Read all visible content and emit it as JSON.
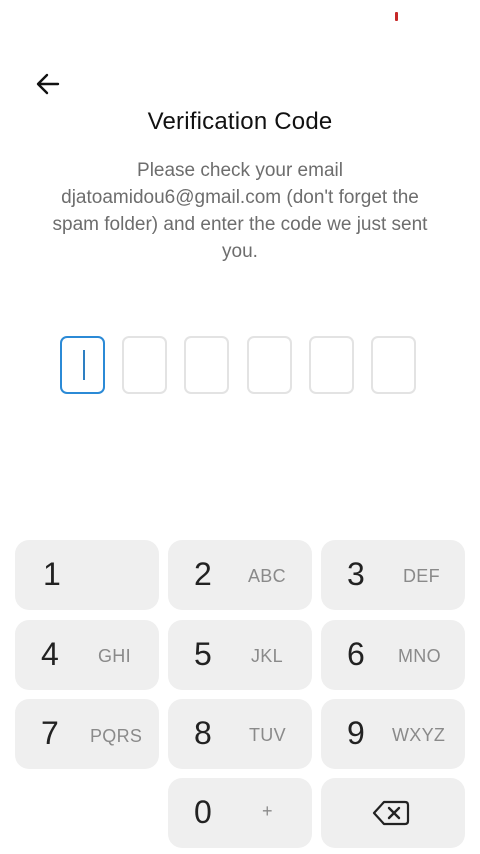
{
  "status_bar": {
    "indicator_color": "#c62828"
  },
  "header": {
    "back_icon": "arrow-left-icon",
    "title": "Verification Code",
    "message": "Please check your email djatoamidou6@gmail.com (don't forget the spam folder) and enter the code we just sent you."
  },
  "otp": {
    "length": 6,
    "values": [
      "",
      "",
      "",
      "",
      "",
      ""
    ],
    "active_index": 0,
    "active_color": "#2b8ad6"
  },
  "keypad": {
    "keys": [
      {
        "digit": "1",
        "letters": ""
      },
      {
        "digit": "2",
        "letters": "ABC"
      },
      {
        "digit": "3",
        "letters": "DEF"
      },
      {
        "digit": "4",
        "letters": "GHI"
      },
      {
        "digit": "5",
        "letters": "JKL"
      },
      {
        "digit": "6",
        "letters": "MNO"
      },
      {
        "digit": "7",
        "letters": "PQRS"
      },
      {
        "digit": "8",
        "letters": "TUV"
      },
      {
        "digit": "9",
        "letters": "WXYZ"
      },
      {
        "digit": "0",
        "letters": "+"
      }
    ],
    "backspace_icon": "backspace-icon"
  }
}
